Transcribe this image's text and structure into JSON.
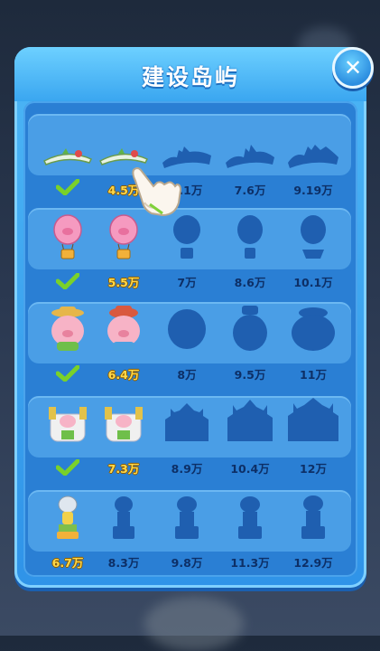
{
  "title": "建设岛屿",
  "rows": [
    {
      "name": "row-1",
      "labels": [
        "",
        "4.5万",
        "6.1万",
        "7.6万",
        "9.19万"
      ],
      "built": 1,
      "current": 1
    },
    {
      "name": "row-2",
      "labels": [
        "",
        "5.5万",
        "7万",
        "8.6万",
        "10.1万"
      ],
      "built": 1,
      "current": 1
    },
    {
      "name": "row-3",
      "labels": [
        "",
        "6.4万",
        "8万",
        "9.5万",
        "11万"
      ],
      "built": 1,
      "current": 1
    },
    {
      "name": "row-4",
      "labels": [
        "",
        "7.3万",
        "8.9万",
        "10.4万",
        "12万"
      ],
      "built": 1,
      "current": 1
    },
    {
      "name": "row-5",
      "labels": [
        "6.7万",
        "8.3万",
        "9.8万",
        "11.3万",
        "12.9万"
      ],
      "built": 0,
      "current": 0
    }
  ],
  "icons": {
    "close": "close-icon",
    "check": "checkmark-icon",
    "hand": "pointing-hand-icon"
  },
  "colors": {
    "panel": "#3aa6f0",
    "silhouette": "#1f5fb0",
    "cost_current": "#ffd94a",
    "cost": "#0d2f66",
    "check": "#7ad12a"
  }
}
